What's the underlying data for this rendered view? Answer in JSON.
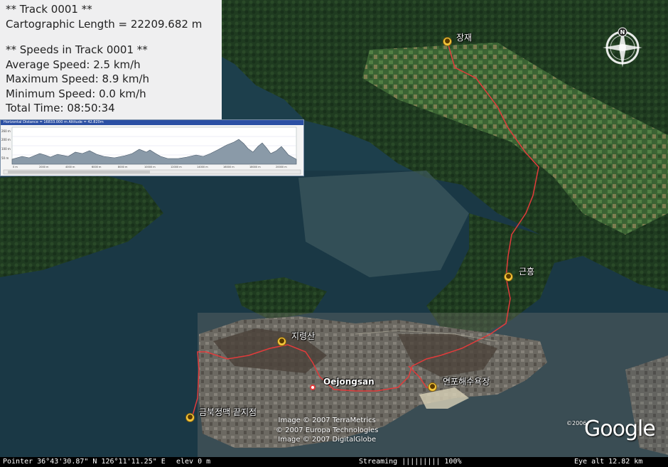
{
  "info_panel": {
    "track_title": "**  Track 0001 **",
    "cartographic_length": "Cartographic Length = 22209.682 m",
    "speeds_title": "** Speeds in Track 0001 **",
    "average_speed": "Average Speed: 2.5 km/h",
    "maximum_speed": "Maximum Speed: 8.9 km/h",
    "minimum_speed": "Minimum Speed: 0.0 km/h",
    "total_time": "Total Time: 08:50:34"
  },
  "elevation_profile": {
    "header": "Horizontal Distance = 16833.000 m    Altitude = 42.820m",
    "y_ticks": [
      "260 m",
      "200 m",
      "100 m",
      "50 m"
    ],
    "x_ticks": [
      "0 m",
      "2000 m",
      "4000 m",
      "6000 m",
      "8000 m",
      "10000 m",
      "12000 m",
      "14000 m",
      "16000 m",
      "18000 m",
      "20000 m"
    ]
  },
  "places": {
    "jangjae": "장재",
    "geunheung": "근흥",
    "jiryeongsan": "지령산",
    "oejongsan": "Oejongsan",
    "yeonpo_beach": "연포해수욕장",
    "geumbuk_end": "금북정맥 끝지점"
  },
  "compass": {
    "north_label": "N"
  },
  "copyright": {
    "line1": "Image © 2007 TerraMetrics",
    "line2": "© 2007 Europa Technologies",
    "line3": "Image © 2007 DigitalGlobe"
  },
  "logo": {
    "text": "Google",
    "year": "©2006"
  },
  "status_bar": {
    "pointer": "Pointer 36°43'30.87\"  N  126°11'11.25\"  E",
    "elevation": "elev    0 m",
    "streaming": "Streaming ||||||||| 100%",
    "eye_alt": "Eye alt    12.82 km"
  }
}
